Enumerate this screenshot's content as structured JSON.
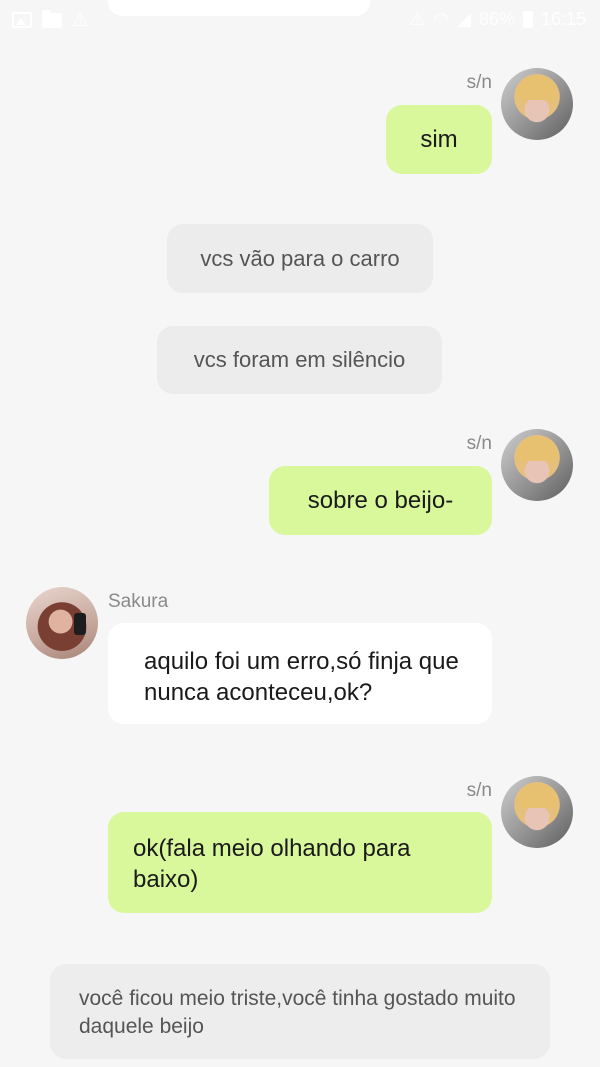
{
  "status_bar": {
    "icons_left": [
      "image-icon",
      "folder-icon",
      "warning-icon"
    ],
    "icons_right": [
      "warning-icon",
      "wifi-icon",
      "signal-icon",
      "battery-icon"
    ],
    "battery": "86%",
    "time": "16:15"
  },
  "messages": [
    {
      "type": "outgoing",
      "sender": "s/n",
      "text": "sim"
    },
    {
      "type": "narration",
      "text": "vcs vão para o carro"
    },
    {
      "type": "narration",
      "text": "vcs foram em silêncio"
    },
    {
      "type": "outgoing",
      "sender": "s/n",
      "text": "sobre o beijo-"
    },
    {
      "type": "incoming",
      "sender": "Sakura",
      "text": "aquilo foi um erro,só finja que nunca aconteceu,ok?"
    },
    {
      "type": "outgoing",
      "sender": "s/n",
      "text": "ok(fala meio olhando para baixo)"
    },
    {
      "type": "narration",
      "text": "você ficou meio triste,você tinha gostado muito daquele beijo"
    }
  ],
  "colors": {
    "background": "#f6f6f6",
    "outgoing_bubble": "#d9f79b",
    "incoming_bubble": "#ffffff",
    "narration_bubble": "#ececec"
  }
}
